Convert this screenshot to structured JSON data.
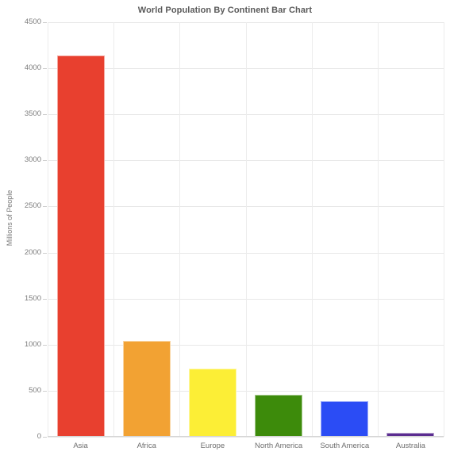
{
  "chart_data": {
    "type": "bar",
    "title": "World Population By Continent Bar Chart",
    "xlabel": "",
    "ylabel": "Millions of People",
    "categories": [
      "Asia",
      "Africa",
      "Europe",
      "North America",
      "South America",
      "Australia"
    ],
    "values": [
      4140,
      1040,
      740,
      460,
      390,
      45
    ],
    "series": [
      {
        "name": "Millions of People",
        "values": [
          4140,
          1040,
          740,
          460,
          390,
          45
        ]
      }
    ],
    "bar_colors": [
      "#e8402f",
      "#f2a233",
      "#fcee36",
      "#3d8b0b",
      "#2b4cf5",
      "#5b2d90"
    ],
    "ylim": [
      0,
      4500
    ],
    "y_ticks": [
      0,
      500,
      1000,
      1500,
      2000,
      2500,
      3000,
      3500,
      4000,
      4500
    ],
    "y_tick_labels": [
      "0",
      "500",
      "1000",
      "1500",
      "2000",
      "2500",
      "3000",
      "3500",
      "4000",
      "4500"
    ],
    "grid": true,
    "grid_axis": "both",
    "legend": false,
    "legend_position": "none",
    "background_color": "#ffffff",
    "grid_color": "#e8e8e8",
    "title_color": "#5a5a5a",
    "tick_label_color": "#7d7d7d"
  }
}
